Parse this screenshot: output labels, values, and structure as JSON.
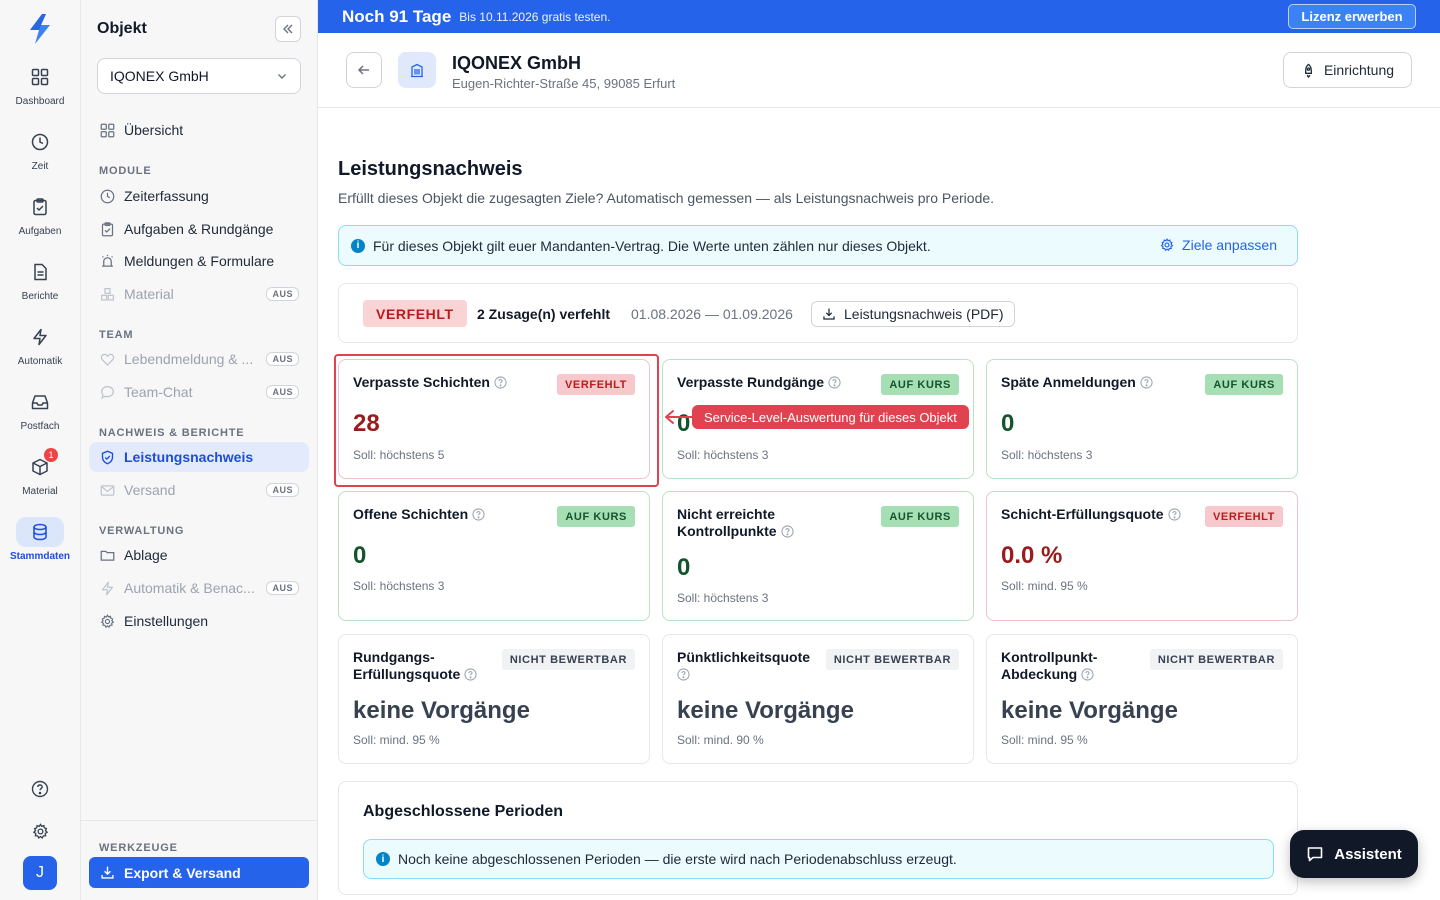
{
  "rail": {
    "items": [
      {
        "label": "Dashboard"
      },
      {
        "label": "Zeit"
      },
      {
        "label": "Aufgaben"
      },
      {
        "label": "Berichte"
      },
      {
        "label": "Automatik"
      },
      {
        "label": "Postfach"
      },
      {
        "label": "Material",
        "badge": "1"
      },
      {
        "label": "Stammdaten"
      }
    ],
    "avatar": "J"
  },
  "sidebar": {
    "title": "Objekt",
    "object_select": "IQONEX GmbH",
    "overview": "Übersicht",
    "sections": {
      "module": "MODULE",
      "team": "TEAM",
      "nachweis": "NACHWEIS & BERICHTE",
      "verwaltung": "VERWALTUNG",
      "werkzeuge": "WERKZEUGE"
    },
    "module_items": [
      "Zeiterfassung",
      "Aufgaben & Rundgänge",
      "Meldungen & Formulare",
      "Material"
    ],
    "team_items": [
      "Lebendmeldung & ...",
      "Team-Chat"
    ],
    "nachweis_items": [
      "Leistungsnachweis",
      "Versand"
    ],
    "verwaltung_items": [
      "Ablage",
      "Automatik & Benac...",
      "Einstellungen"
    ],
    "off_badge": "AUS",
    "export": "Export & Versand"
  },
  "trial": {
    "title": "Noch 91 Tage",
    "subtitle": "Bis 10.11.2026 gratis testen.",
    "button": "Lizenz erwerben"
  },
  "object": {
    "name": "IQONEX GmbH",
    "address": "Eugen-Richter-Straße 45, 99085 Erfurt",
    "setup_button": "Einrichtung"
  },
  "page": {
    "title": "Leistungsnachweis",
    "subtitle": "Erfüllt dieses Objekt die zugesagten Ziele? Automatisch gemessen — als Leistungsnachweis pro Periode.",
    "info": "Für dieses Objekt gilt euer Mandanten-Vertrag. Die Werte unten zählen nur dieses Objekt.",
    "info_link": "Ziele anpassen"
  },
  "status": {
    "pill": "VERFEHLT",
    "count": "2 Zusage(n) verfehlt",
    "period": "01.08.2026 — 01.09.2026",
    "pdf_button": "Leistungsnachweis (PDF)"
  },
  "kpis": [
    {
      "title": "Verpasste Schichten",
      "badge": "VERFEHLT",
      "value": "28",
      "target": "Soll: höchstens 5"
    },
    {
      "title": "Verpasste Rundgänge",
      "badge": "AUF KURS",
      "value": "0",
      "target": "Soll: höchstens 3"
    },
    {
      "title": "Späte Anmeldungen",
      "badge": "AUF KURS",
      "value": "0",
      "target": "Soll: höchstens 3"
    },
    {
      "title": "Offene Schichten",
      "badge": "AUF KURS",
      "value": "0",
      "target": "Soll: höchstens 3"
    },
    {
      "title": "Nicht erreichte Kontrollpunkte",
      "badge": "AUF KURS",
      "value": "0",
      "target": "Soll: höchstens 3"
    },
    {
      "title": "Schicht-Erfüllungsquote",
      "badge": "VERFEHLT",
      "value": "0.0 %",
      "target": "Soll: mind. 95 %"
    },
    {
      "title": "Rundgangs-Erfüllungsquote",
      "badge": "NICHT BEWERTBAR",
      "value": "keine Vorgänge",
      "target": "Soll: mind. 95 %"
    },
    {
      "title": "Pünktlichkeitsquote",
      "badge": "NICHT BEWERTBAR",
      "value": "keine Vorgänge",
      "target": "Soll: mind. 90 %"
    },
    {
      "title": "Kontrollpunkt-Abdeckung",
      "badge": "NICHT BEWERTBAR",
      "value": "keine Vorgänge",
      "target": "Soll: mind. 95 %"
    }
  ],
  "callout": "Service-Level-Auswertung für dieses Objekt",
  "periods": {
    "title": "Abgeschlossene Perioden",
    "info": "Noch keine abgeschlossenen Perioden — die erste wird nach Periodenabschluss erzeugt."
  },
  "assistant": "Assistent",
  "colors": {
    "accent": "#2563eb",
    "ok": "#14532d",
    "bad": "#b91c1c",
    "highlight": "#e0434f"
  }
}
